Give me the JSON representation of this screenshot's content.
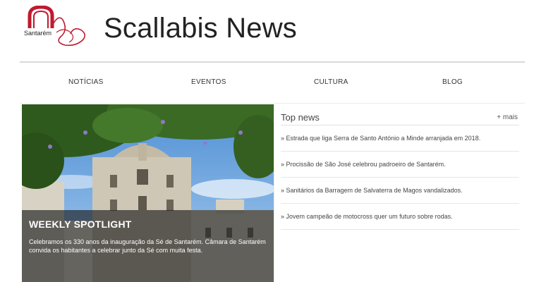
{
  "header": {
    "logo_text": "Santarém",
    "site_title": "Scallabis News"
  },
  "nav": {
    "items": [
      "NOTÍCIAS",
      "EVENTOS",
      "CULTURA",
      "BLOG"
    ]
  },
  "spotlight": {
    "title": "WEEKLY SPOTLIGHT",
    "description": "Celebramos os 330 anos da inauguração da Sé de Santarém. Câmara de Santarém convida os habitantes a celebrar junto da Sé com muita festa."
  },
  "top_news": {
    "title": "Top news",
    "more_label": "+ mais",
    "items": [
      "» Estrada que liga Serra de Santo António a Minde arranjada em 2018.",
      "» Procissão de São José celebrou padroeiro de Santarém.",
      "» Sanitários da Barragem de Salvaterra de Magos vandalizados.",
      "» Jovem campeão de motocross quer um futuro sobre rodas."
    ]
  },
  "colors": {
    "logo_red": "#c0192f",
    "overlay": "#141414",
    "sky": "#6fa6dd"
  }
}
